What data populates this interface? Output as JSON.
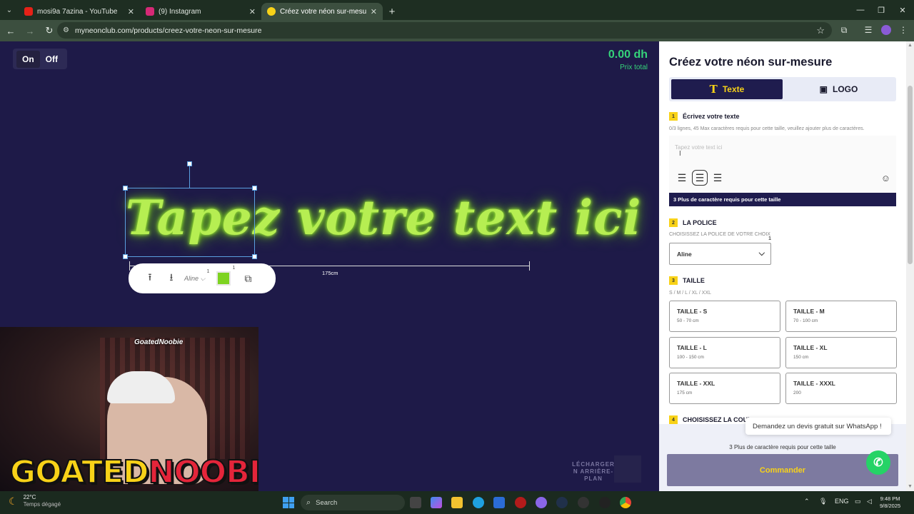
{
  "browser": {
    "tabs": [
      {
        "title": "mosi9a 7azina - YouTube",
        "favicon_color": "#e62117"
      },
      {
        "title": "(9) Instagram",
        "favicon_color": "#d62976"
      },
      {
        "title": "Créez votre néon sur-mesure -",
        "favicon_color": "#f8d218"
      }
    ],
    "url": "myneonclub.com/products/creez-votre-neon-sur-mesure"
  },
  "canvas": {
    "toggle_on": "On",
    "toggle_off": "Off",
    "price": "0.00 dh",
    "price_label": "Prix total",
    "neon_text": "Tapez votre text ici",
    "measure_label": "175cm",
    "neon_color": "#7ed321",
    "toolbar_font": "Aline",
    "toolbar_font_sup": "1",
    "toolbar_color_sup": "1",
    "bg_download": "LÉCHARGER\nN ARRIÈRE-\nPLAN"
  },
  "webcam": {
    "tag": "GoatedNoobie",
    "brand_a": "GOATED",
    "brand_b": "NOOBIE"
  },
  "panel": {
    "title": "Créez votre néon sur-mesure",
    "tab_text": "Texte",
    "tab_logo": "LOGO",
    "step1": {
      "num": "1",
      "title": "Écrivez votre texte",
      "hint": "0/3 lignes, 45 Max caractères requis pour cette taille, veuillez ajouter plus de caractères.",
      "placeholder": "Tapez votre text ici"
    },
    "notice": "3 Plus de caractère requis pour cette taille",
    "step2": {
      "num": "2",
      "title": "LA POLICE",
      "sub": "CHOISISSEZ LA POLICE DE VOTRE CHOIX",
      "selected_font": "Aline",
      "sup": "1"
    },
    "step3": {
      "num": "3",
      "title": "TAILLE",
      "sub": "S / M / L / XL / XXL",
      "sizes": [
        {
          "name": "TAILLE - S",
          "range": "50 - 70 cm"
        },
        {
          "name": "TAILLE - M",
          "range": "70 - 100 cm"
        },
        {
          "name": "TAILLE - L",
          "range": "100 - 150 cm"
        },
        {
          "name": "TAILLE - XL",
          "range": "150 cm"
        },
        {
          "name": "TAILLE - XXL",
          "range": "175 cm"
        },
        {
          "name": "TAILLE - XXXL",
          "range": "200"
        }
      ]
    },
    "step4": {
      "num": "4",
      "title": "CHOISISSEZ LA COUL"
    },
    "required_note": "3 Plus de caractère requis pour cette taille",
    "order_button": "Commander",
    "whatsapp_bubble": "Demandez un devis gratuit sur WhatsApp !"
  },
  "taskbar": {
    "temp": "22°C",
    "weather": "Temps dégagé",
    "search": "Search",
    "lang": "ENG",
    "time": "9:48 PM",
    "date": "9/8/2025"
  }
}
